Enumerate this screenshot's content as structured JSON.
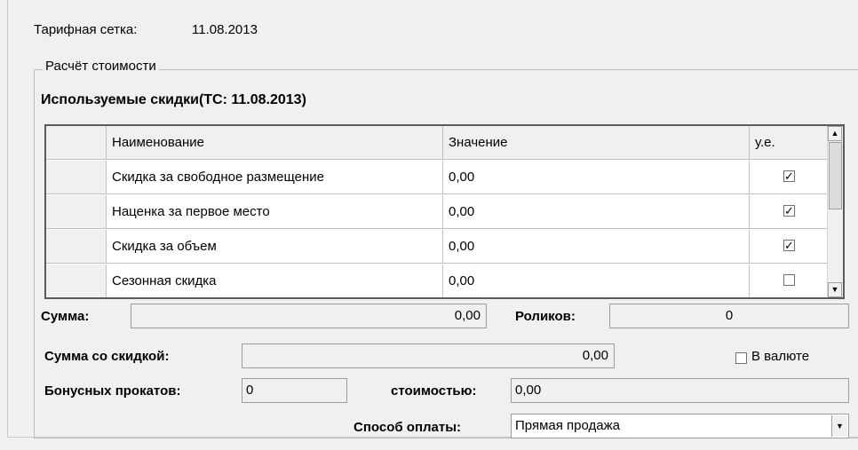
{
  "tariff": {
    "label": "Тарифная сетка:",
    "date": "11.08.2013"
  },
  "group": {
    "legend": "Расчёт стоимости"
  },
  "discounts": {
    "title": "Используемые скидки(ТС: 11.08.2013)",
    "columns": [
      "Наименование",
      "Значение",
      "у.е."
    ],
    "rows": [
      {
        "name": "Скидка за свободное размещение",
        "value": "0,00",
        "ue": true
      },
      {
        "name": "Наценка за первое место",
        "value": "0,00",
        "ue": true
      },
      {
        "name": "Скидка за объем",
        "value": "0,00",
        "ue": true
      },
      {
        "name": "Сезонная скидка",
        "value": "0,00",
        "ue": false
      }
    ]
  },
  "totals": {
    "sum_label": "Сумма:",
    "sum_value": "0,00",
    "clips_label": "Роликов:",
    "clips_value": "0",
    "discounted_label": "Сумма со скидкой:",
    "discounted_value": "0,00",
    "currency_label": "В валюте",
    "currency_checked": false,
    "bonus_label": "Бонусных прокатов:",
    "bonus_value": "0",
    "cost_label": "стоимостью:",
    "cost_value": "0,00",
    "payment_label": "Способ оплаты:",
    "payment_value": "Прямая продажа"
  }
}
